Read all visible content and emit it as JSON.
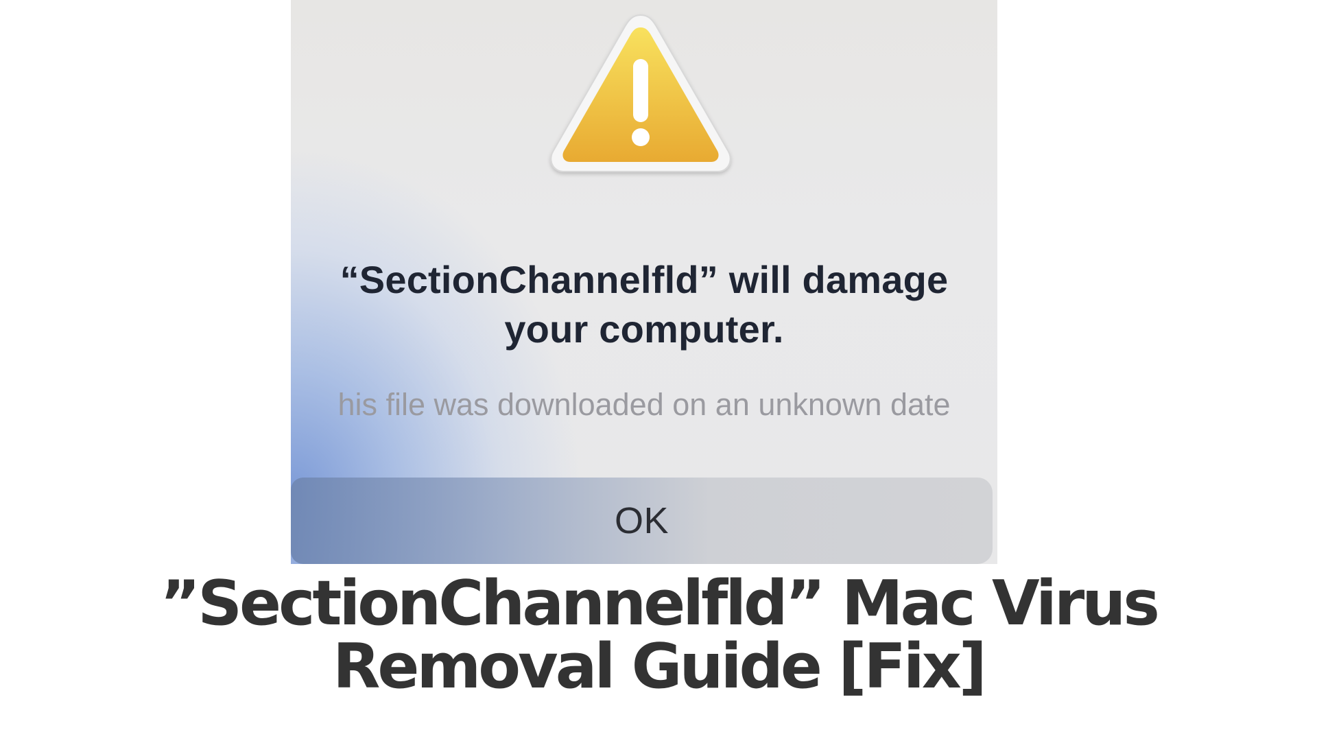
{
  "dialog": {
    "icon": "warning-triangle-icon",
    "title_line1": "“SectionChannelfld” will damage",
    "title_line2": "your computer.",
    "message": "his file was downloaded on an unknown date",
    "ok_label": "OK",
    "colors": {
      "icon_fill": "#f0be3e",
      "title": "#1f2533",
      "message": "#9a9aa0",
      "accent_blue": "#7696d6"
    }
  },
  "headline": {
    "line1": "”SectionChannelfld” Mac Virus",
    "line2": "Removal Guide [Fix]",
    "color": "#333333"
  }
}
